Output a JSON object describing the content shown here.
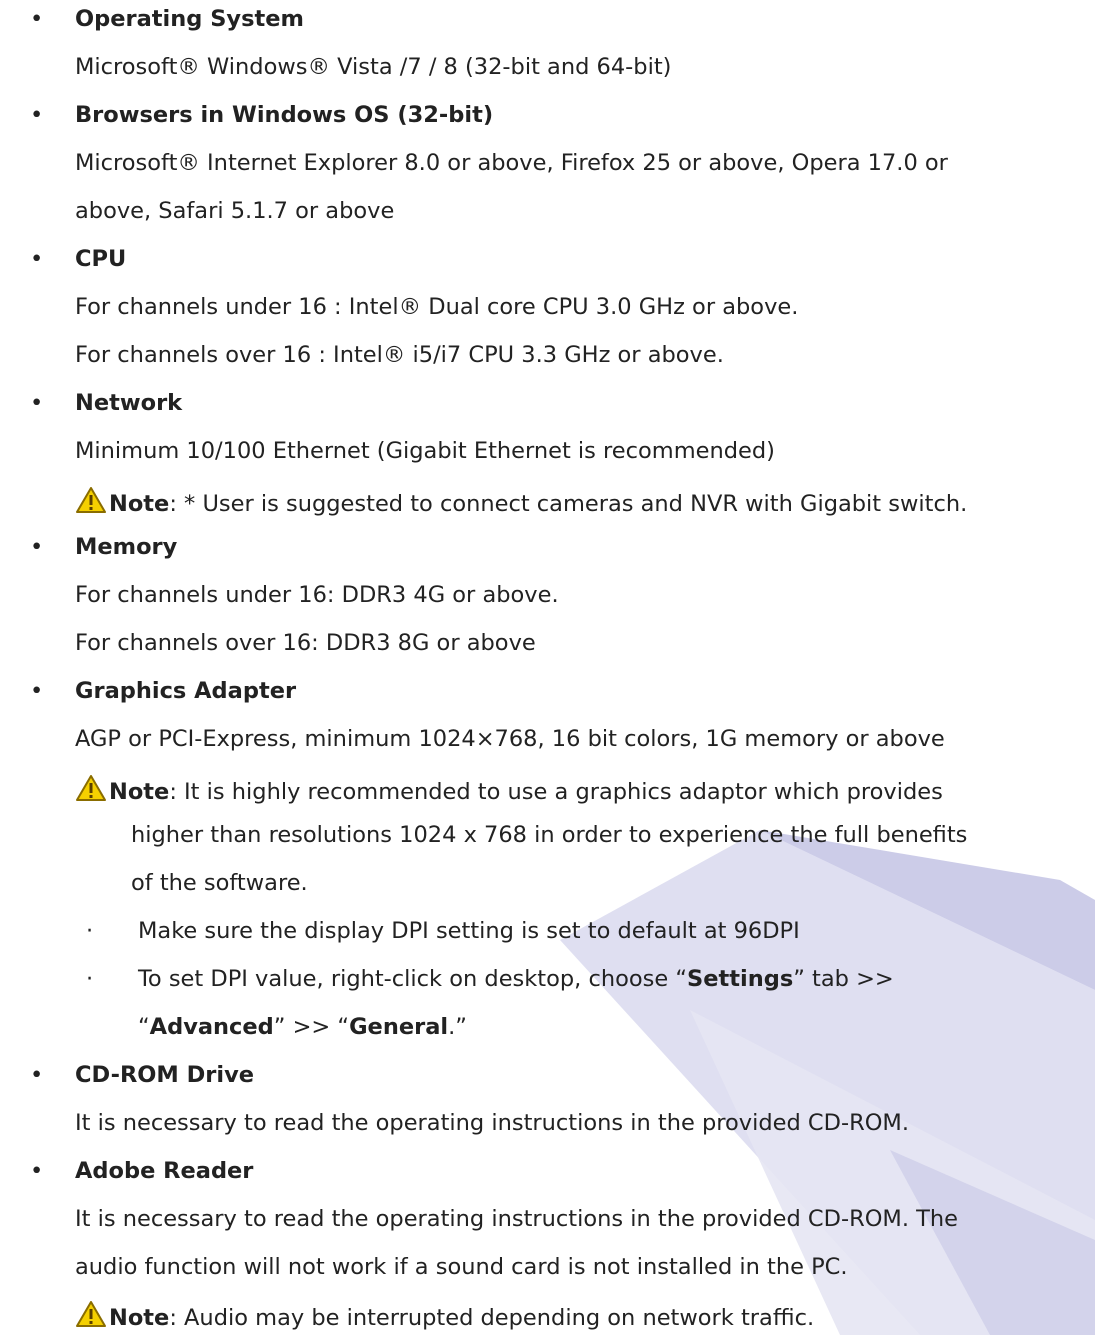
{
  "sections": [
    {
      "title": "Operating System",
      "lines": [
        "Microsoft® Windows® Vista /7 / 8 (32-bit and 64-bit)"
      ]
    },
    {
      "title": "Browsers in Windows OS (32-bit)",
      "lines": [
        "Microsoft® Internet Explorer 8.0 or above, Firefox 25 or above, Opera 17.0 or",
        "above, Safari 5.1.7 or above"
      ]
    },
    {
      "title": "CPU",
      "lines": [
        "For channels under 16 : Intel® Dual core CPU 3.0 GHz or above.",
        "For channels over 16 : Intel® i5/i7 CPU 3.3 GHz or above."
      ]
    },
    {
      "title": "Network",
      "lines": [
        "Minimum 10/100 Ethernet (Gigabit Ethernet is recommended)"
      ],
      "note": {
        "label": "Note",
        "text": ": * User is suggested to connect cameras and NVR with Gigabit switch."
      }
    },
    {
      "title": "Memory",
      "lines": [
        "For channels under 16: DDR3 4G or above.",
        "For channels over 16: DDR3 8G or above"
      ]
    },
    {
      "title": "Graphics Adapter",
      "lines": [
        "AGP or PCI-Express, minimum 1024×768, 16 bit colors, 1G memory or above"
      ],
      "note": {
        "label": "Note",
        "text": ": It is highly recommended to use a graphics adaptor which provides",
        "cont": [
          "higher than resolutions 1024 x 768 in order to experience the full benefits",
          "of the software."
        ]
      },
      "sub_items": [
        {
          "text": "Make sure the display DPI setting is set to default at 96DPI"
        },
        {
          "t1": "To set DPI value, right-click on desktop, choose “",
          "b1": "Settings",
          "t2": "” tab >>",
          "t3": "“",
          "b2": "Advanced",
          "t4": "” >> “",
          "b3": "General",
          "t5": ".”"
        }
      ]
    },
    {
      "title": "CD-ROM Drive",
      "lines": [
        "It is necessary to read the operating instructions in the provided CD-ROM."
      ]
    },
    {
      "title": "Adobe Reader",
      "lines": [
        "It is necessary to read the operating instructions in the provided CD-ROM. The",
        "audio function will not work if a sound card is not installed in the PC."
      ],
      "note": {
        "label": "Note",
        "text": ": Audio may be interrupted depending on network traffic."
      }
    }
  ],
  "bullet_glyph": "•",
  "sub_bullet_glyph": "·",
  "icons": {
    "warning": "warning-triangle-icon"
  },
  "colors": {
    "text": "#222222",
    "warning_fill": "#f5d000",
    "warning_stroke": "#8a6d00",
    "watermark": "#c7c7e6"
  }
}
